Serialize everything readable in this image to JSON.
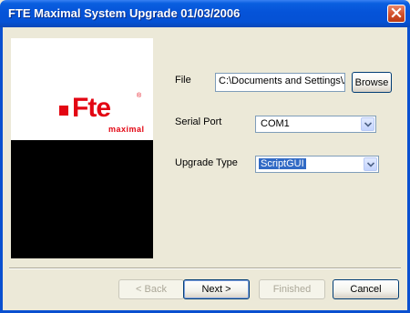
{
  "window": {
    "title": "FTE Maximal System Upgrade 01/03/2006",
    "close_icon": "close-icon"
  },
  "logo": {
    "brand": "Fte",
    "registered": "®",
    "sub": "maximal"
  },
  "form": {
    "file_label": "File",
    "file_value": "C:\\Documents and Settings\\A",
    "browse_label": "Browse",
    "serial_port_label": "Serial Port",
    "serial_port_value": "COM1",
    "upgrade_type_label": "Upgrade Type",
    "upgrade_type_value": "ScriptGUI"
  },
  "footer": {
    "back_label": "< Back",
    "next_label": "Next >",
    "finished_label": "Finished",
    "cancel_label": "Cancel"
  },
  "colors": {
    "brand_red": "#E30613",
    "titlebar_blue": "#0553D8",
    "selection_blue": "#316AC5"
  }
}
